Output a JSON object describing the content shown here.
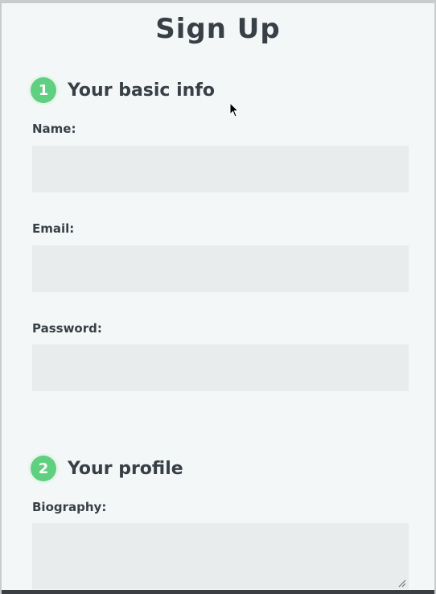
{
  "form": {
    "title": "Sign Up",
    "sections": [
      {
        "number": "1",
        "title": "Your basic info"
      },
      {
        "number": "2",
        "title": "Your profile"
      }
    ],
    "fields": {
      "name": {
        "label": "Name:",
        "value": ""
      },
      "email": {
        "label": "Email:",
        "value": ""
      },
      "password": {
        "label": "Password:",
        "value": ""
      },
      "biography": {
        "label": "Biography:",
        "value": ""
      }
    }
  },
  "colors": {
    "background": "#f4f7f8",
    "field_background": "#e9eced",
    "badge": "#5fcf80",
    "text": "#384047"
  },
  "icons": {
    "cursor": "mouse-pointer-icon",
    "resize": "textarea-resize-icon"
  }
}
